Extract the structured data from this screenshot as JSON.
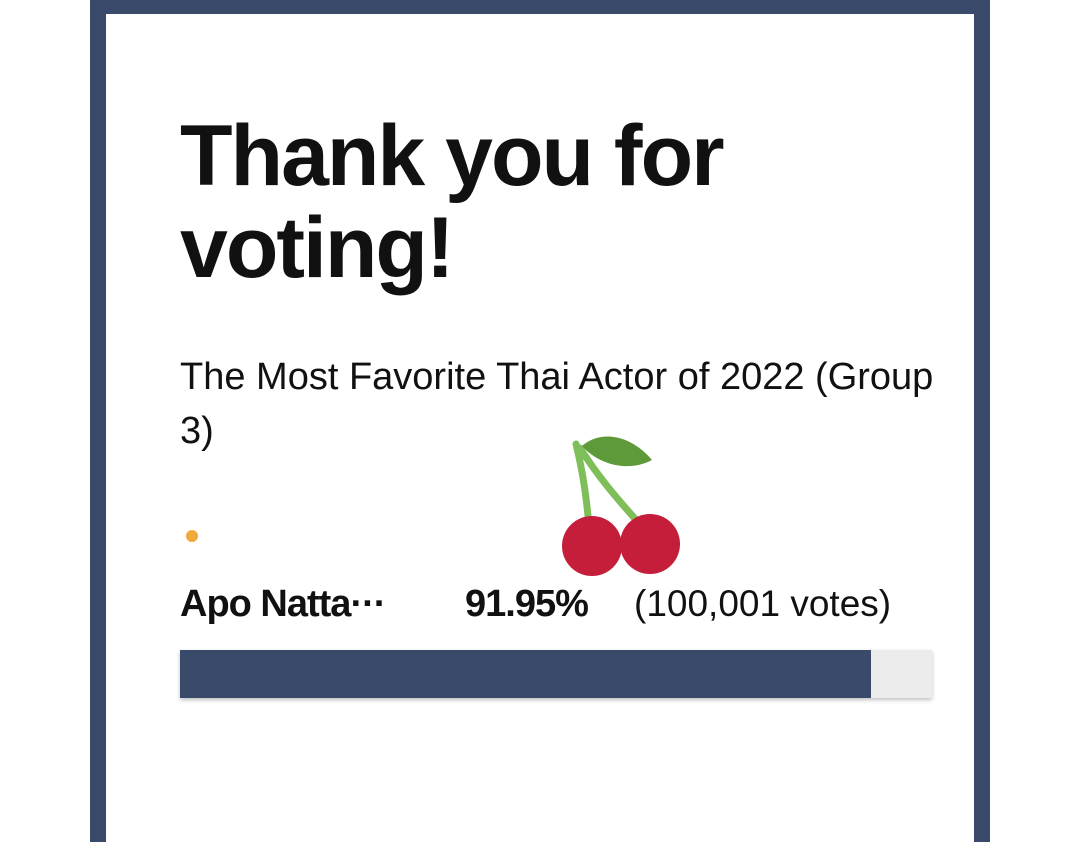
{
  "heading": "Thank you for voting!",
  "poll": {
    "title": "The Most Favorite Thai Actor of 2022 (Group 3)"
  },
  "result": {
    "name": "Apo Natta···",
    "percent_text": "91.95%",
    "votes_text": "(100,001 votes)",
    "progress": 0.9195
  },
  "colors": {
    "accent": "#3a4a6b",
    "dot": "#f2a93b",
    "track": "#ececec"
  },
  "decoration": {
    "icon": "cherry-icon"
  }
}
